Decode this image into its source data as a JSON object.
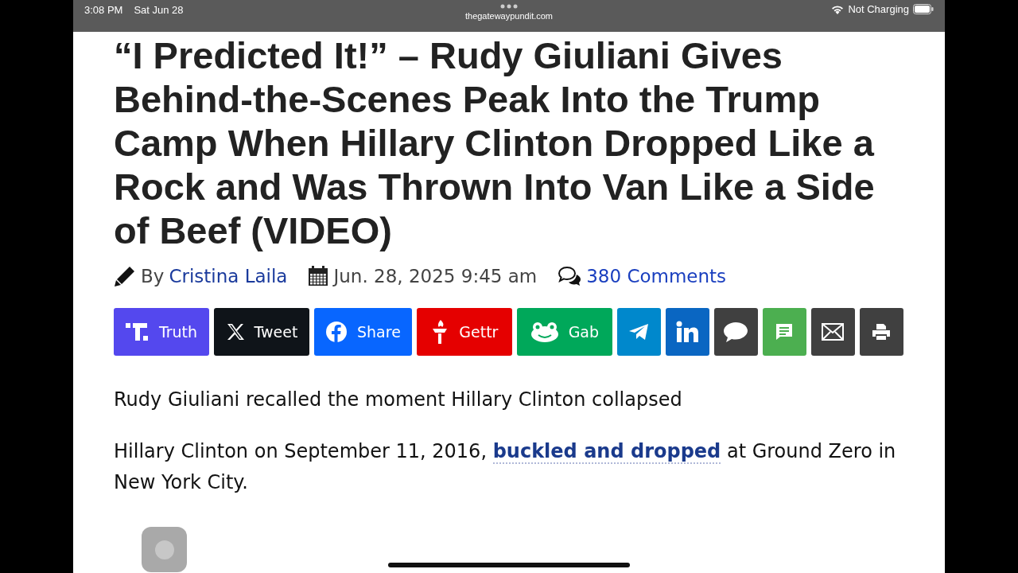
{
  "status_bar": {
    "time": "3:08 PM",
    "date": "Sat Jun 28",
    "url": "thegatewaypundit.com",
    "charging": "Not Charging"
  },
  "article": {
    "title": "“I Predicted It!” – Rudy Giuliani Gives Behind-the-Scenes Peak Into the Trump Camp When Hillary Clinton Dropped Like a Rock and Was Thrown Into Van Like a Side of Beef (VIDEO)",
    "byline": {
      "by": "By",
      "author": "Cristina Laila",
      "date": "Jun. 28, 2025 9:45 am",
      "comments": "380 Comments"
    },
    "share_buttons": [
      {
        "kind": "truth",
        "label": "Truth",
        "color": "#5448ee"
      },
      {
        "kind": "x",
        "label": "Tweet",
        "color": "#0f1419"
      },
      {
        "kind": "facebook",
        "label": "Share",
        "color": "#0866ff"
      },
      {
        "kind": "gettr",
        "label": "Gettr",
        "color": "#e50000"
      },
      {
        "kind": "gab",
        "label": "Gab",
        "color": "#00a85a"
      },
      {
        "kind": "telegram",
        "color": "#0088cc"
      },
      {
        "kind": "linkedin",
        "color": "#0a66c2"
      },
      {
        "kind": "comment",
        "color": "#404040"
      },
      {
        "kind": "sms",
        "color": "#4caf50"
      },
      {
        "kind": "email",
        "color": "#404040"
      },
      {
        "kind": "print",
        "color": "#404040"
      }
    ],
    "paragraphs": [
      {
        "text": "Rudy Giuliani recalled the moment Hillary Clinton collapsed"
      },
      {
        "text": "Hillary Clinton on September 11, 2016,",
        "link": "buckled and dropped",
        "after": "at Ground Zero in New York City."
      }
    ]
  }
}
